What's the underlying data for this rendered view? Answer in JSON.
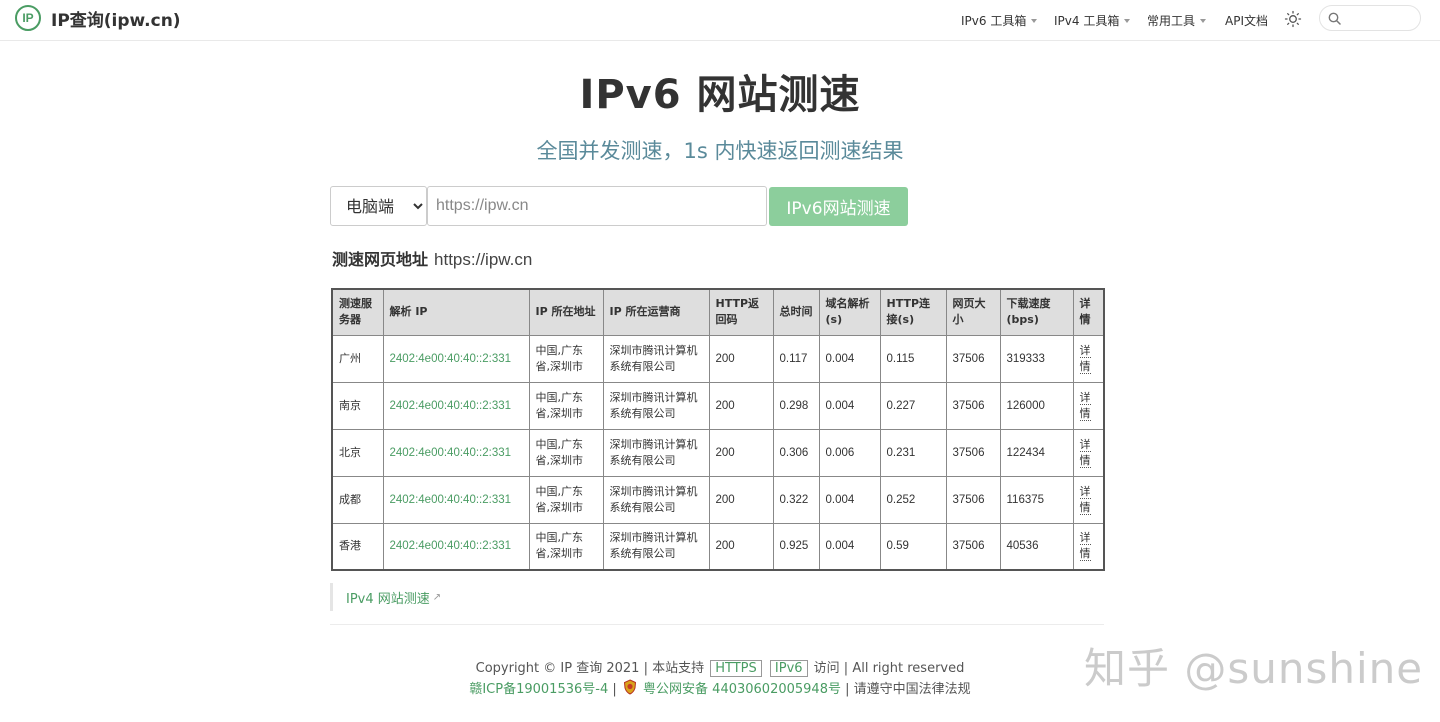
{
  "header": {
    "logo_icon_text": "IP",
    "logo_text": "IP查询(ipw.cn)",
    "nav": [
      {
        "label": "IPv6 工具箱",
        "has_caret": true
      },
      {
        "label": "IPv4 工具箱",
        "has_caret": true
      },
      {
        "label": "常用工具",
        "has_caret": true
      },
      {
        "label": "API文档",
        "has_caret": false
      }
    ],
    "theme_icon": "sun-icon",
    "search": {
      "value": "",
      "placeholder": ""
    }
  },
  "hero": {
    "title": "IPv6 网站测速",
    "subtitle": "全国并发测速，1s 内快速返回测速结果"
  },
  "form": {
    "device_selected": "电脑端",
    "url_placeholder": "https://ipw.cn",
    "url_value": "",
    "button_label": "IPv6网站测速",
    "button_color": "#8cce9c"
  },
  "result": {
    "url_label": "测速网页地址",
    "url_value": "https://ipw.cn"
  },
  "table": {
    "headers": [
      "测速服务器",
      "解析 IP",
      "IP 所在地址",
      "IP 所在运营商",
      "HTTP返回码",
      "总时间",
      "域名解析(s)",
      "HTTP连接(s)",
      "网页大小",
      "下载速度(bps)",
      "详情"
    ],
    "rows": [
      {
        "server": "广州",
        "ip": "2402:4e00:40:40::2:331",
        "location": "中国,广东省,深圳市",
        "isp": "深圳市腾讯计算机系统有限公司",
        "code": "200",
        "total": "0.117",
        "dns": "0.004",
        "conn": "0.115",
        "size": "37506",
        "speed": "319333",
        "detail": "详情"
      },
      {
        "server": "南京",
        "ip": "2402:4e00:40:40::2:331",
        "location": "中国,广东省,深圳市",
        "isp": "深圳市腾讯计算机系统有限公司",
        "code": "200",
        "total": "0.298",
        "dns": "0.004",
        "conn": "0.227",
        "size": "37506",
        "speed": "126000",
        "detail": "详情"
      },
      {
        "server": "北京",
        "ip": "2402:4e00:40:40::2:331",
        "location": "中国,广东省,深圳市",
        "isp": "深圳市腾讯计算机系统有限公司",
        "code": "200",
        "total": "0.306",
        "dns": "0.006",
        "conn": "0.231",
        "size": "37506",
        "speed": "122434",
        "detail": "详情"
      },
      {
        "server": "成都",
        "ip": "2402:4e00:40:40::2:331",
        "location": "中国,广东省,深圳市",
        "isp": "深圳市腾讯计算机系统有限公司",
        "code": "200",
        "total": "0.322",
        "dns": "0.004",
        "conn": "0.252",
        "size": "37506",
        "speed": "116375",
        "detail": "详情"
      },
      {
        "server": "香港",
        "ip": "2402:4e00:40:40::2:331",
        "location": "中国,广东省,深圳市",
        "isp": "深圳市腾讯计算机系统有限公司",
        "code": "200",
        "total": "0.925",
        "dns": "0.004",
        "conn": "0.59",
        "size": "37506",
        "speed": "40536",
        "detail": "详情"
      }
    ]
  },
  "links": {
    "ipv4_test": "IPv4 网站测速"
  },
  "footer": {
    "copyright": "Copyright © IP 查询 2021 | 本站支持",
    "badge_https": "HTTPS",
    "badge_ipv6": "IPv6",
    "access_suffix": "访问 | All right reserved",
    "icp": "赣ICP备19001536号-4",
    "sep": "|",
    "police": "粤公网安备 44030602005948号",
    "law": "| 请遵守中国法律法规"
  },
  "watermark": "知乎 @sunshine",
  "colors": {
    "accent": "#4a9c63",
    "subtitle": "#5a8a9a"
  }
}
